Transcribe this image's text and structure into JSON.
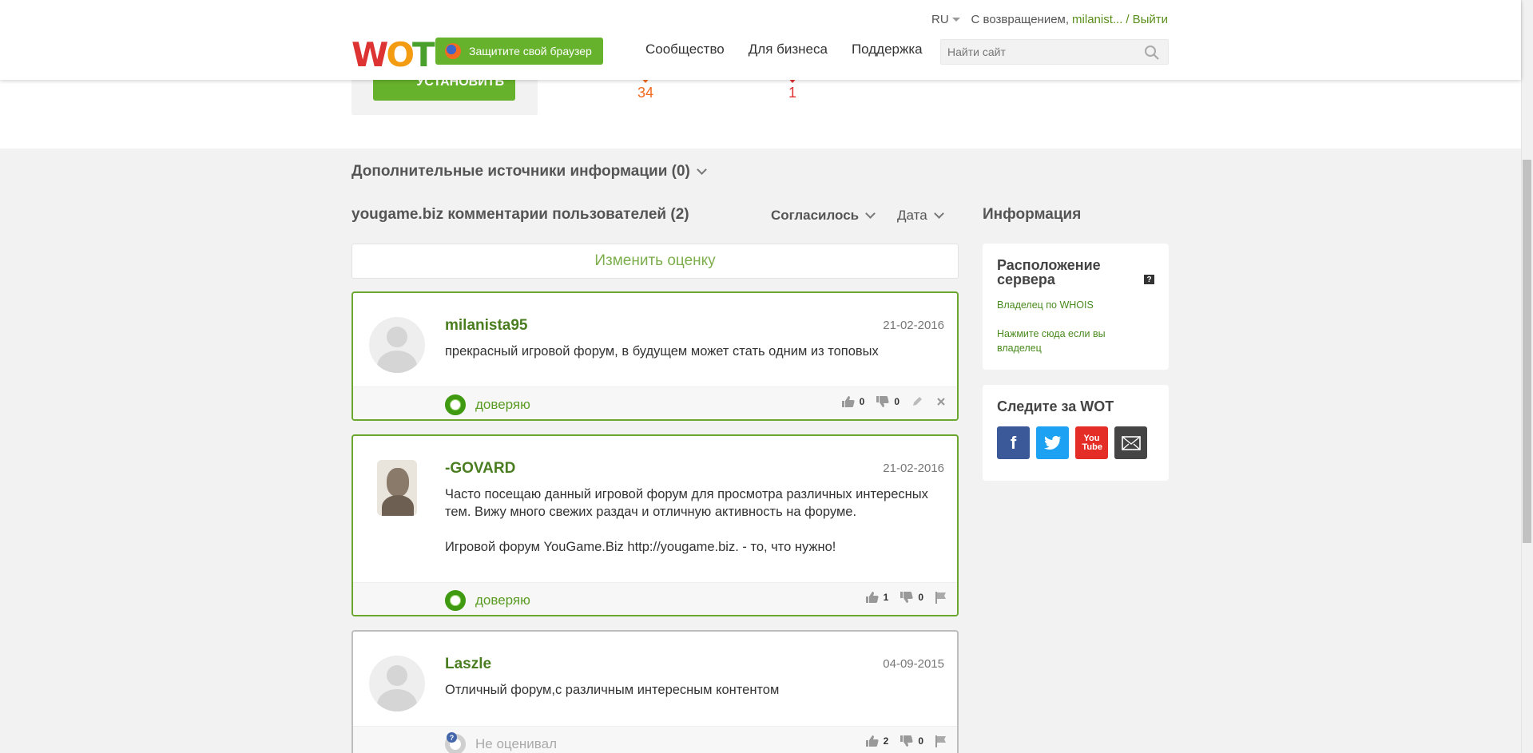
{
  "header": {
    "lang": "RU",
    "welcome_prefix": "С возвращением,",
    "username": "milanist...",
    "separator": "/",
    "logout": "Выйти",
    "logo_letters": [
      "W",
      "O",
      "T"
    ],
    "protect_button": "Защитите свой браузер",
    "nav": [
      "Сообщество",
      "Для бизнеса",
      "Поддержка"
    ],
    "search_placeholder": "Найти сайт"
  },
  "top": {
    "install_label": "УСТАНОВИТЬ",
    "metric_1": "34",
    "metric_2": "1"
  },
  "main": {
    "more_sources": "Дополнительные источники информации (0)",
    "comments_title": "yougame.biz комментарии пользователей (2)",
    "sort_agreement": "Согласилось",
    "sort_date": "Дата",
    "change_rating": "Изменить оценку",
    "comments": [
      {
        "user": "milanista95",
        "date": "21-02-2016",
        "text": "прекрасный игровой форум, в будущем может стать одним из топовых",
        "trust": "доверяю",
        "likes": "0",
        "dislikes": "0"
      },
      {
        "user": "-GOVARD",
        "date": "21-02-2016",
        "text": "Часто посещаю данный игровой форум для просмотра различных интересных тем. Вижу много свежих раздач и отличную активность на форуме.\n\nИгровой форум YouGame.Biz http://yougame.biz. - то, что нужно!",
        "trust": "доверяю",
        "likes": "1",
        "dislikes": "0"
      },
      {
        "user": "Laszle",
        "date": "04-09-2015",
        "text": "Отличный форум,с различным интересным контентом",
        "trust": "Не оценивал",
        "likes": "2",
        "dislikes": "0"
      }
    ]
  },
  "sidebar": {
    "info_title": "Информация",
    "server_title": "Расположение сервера",
    "whois_link": "Владелец по WHOIS",
    "owner_link": "Нажмите сюда если вы владелец",
    "follow_title": "Следите за WOT",
    "social": [
      "facebook-icon",
      "twitter-icon",
      "youtube-icon",
      "email-icon"
    ],
    "youtube_text": "You Tube"
  },
  "colors": {
    "brand_green": "#67b22d",
    "link_green": "#4a7d20",
    "orange": "#f06a1e",
    "red": "#e03030"
  }
}
